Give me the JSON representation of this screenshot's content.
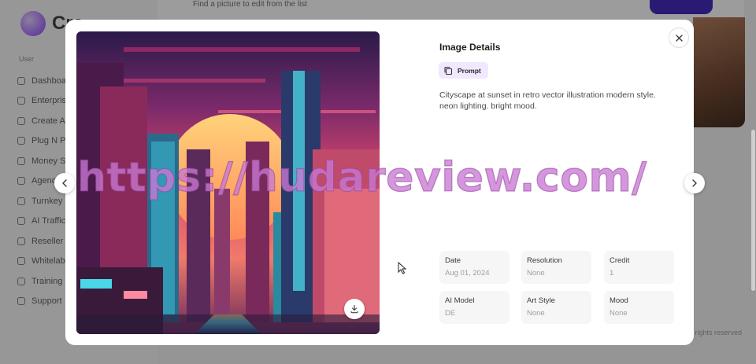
{
  "background": {
    "logo_text": "Cre",
    "section_label": "User",
    "menu": [
      "Dashboard",
      "Enterprise",
      "Create AI",
      "Plug N Play",
      "Money Site",
      "Agency",
      "Turnkey",
      "AI Traffic",
      "Reseller",
      "Whitelabel",
      "Training",
      "Support"
    ],
    "top_text": "Find a picture to edit from the list",
    "footer_text": "All rights reserved"
  },
  "modal": {
    "title": "Image Details",
    "prompt_label": "Prompt",
    "prompt_text": "Cityscape at sunset in retro vector illustration modern style. neon lighting. bright mood.",
    "meta": [
      {
        "label": "Date",
        "value": "Aug 01, 2024"
      },
      {
        "label": "Resolution",
        "value": "None"
      },
      {
        "label": "Credit",
        "value": "1"
      },
      {
        "label": "AI Model",
        "value": "DE"
      },
      {
        "label": "Art Style",
        "value": "None"
      },
      {
        "label": "Mood",
        "value": "None"
      }
    ],
    "icons": {
      "close": "close-icon",
      "prev": "chevron-left-icon",
      "next": "chevron-right-icon",
      "download": "download-icon",
      "prompt": "copy-icon"
    }
  },
  "watermark": "https://hudareview.com/",
  "colors": {
    "chip_bg": "#f0e8ff",
    "watermark": "#c878d2",
    "card_bg": "#f6f6f7"
  }
}
